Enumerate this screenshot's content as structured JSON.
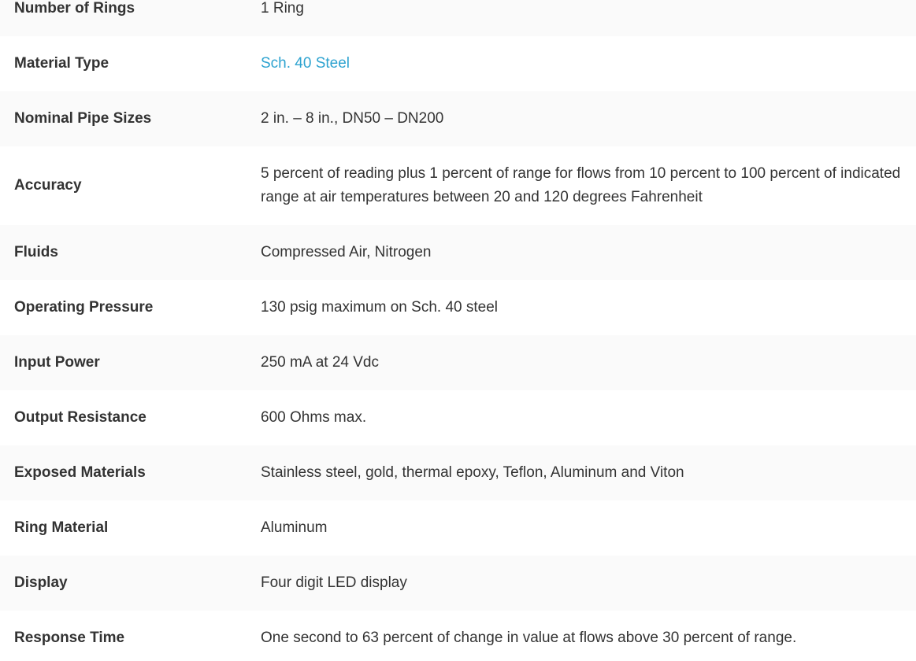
{
  "link_color": "#2ea3d0",
  "specs": [
    {
      "label": "Number of Rings",
      "value": "1 Ring"
    },
    {
      "label": "Material Type",
      "value": "Sch. 40 Steel",
      "is_link": true
    },
    {
      "label": "Nominal Pipe Sizes",
      "value": "2 in. – 8 in., DN50 – DN200"
    },
    {
      "label": "Accuracy",
      "value": "5 percent of reading plus 1 percent of range for flows from 10 percent to 100 percent of indicated range at air temperatures between 20 and 120 degrees Fahrenheit"
    },
    {
      "label": "Fluids",
      "value": "Compressed Air, Nitrogen"
    },
    {
      "label": "Operating Pressure",
      "value": "130 psig maximum on Sch. 40 steel"
    },
    {
      "label": "Input Power",
      "value": "250 mA at 24 Vdc"
    },
    {
      "label": "Output Resistance",
      "value": "600 Ohms max."
    },
    {
      "label": "Exposed Materials",
      "value": "Stainless steel, gold, thermal epoxy, Teflon, Aluminum and Viton"
    },
    {
      "label": "Ring Material",
      "value": "Aluminum"
    },
    {
      "label": "Display",
      "value": "Four digit LED display"
    },
    {
      "label": "Response Time",
      "value": "One second to 63 percent of change in value at flows above 30 percent of range."
    }
  ]
}
